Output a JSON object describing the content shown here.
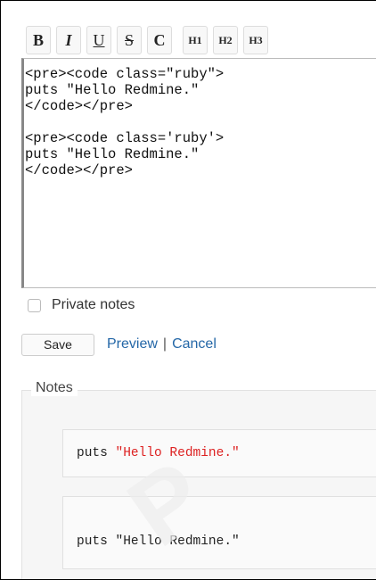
{
  "toolbar": {
    "bold": "B",
    "italic": "I",
    "underline": "U",
    "strike": "S",
    "code": "C",
    "h1": "H1",
    "h2": "H2",
    "h3": "H3"
  },
  "editor": {
    "value": "<pre><code class=\"ruby\">\nputs \"Hello Redmine.\"\n</code></pre>\n\n<pre><code class='ruby'>\nputs \"Hello Redmine.\"\n</code></pre>"
  },
  "private_notes": {
    "label": "Private notes",
    "checked": false
  },
  "actions": {
    "save": "Save",
    "preview": "Preview",
    "separator": "|",
    "cancel": "Cancel"
  },
  "notes": {
    "legend": "Notes",
    "block1": {
      "prefix": "puts ",
      "string": "\"Hello Redmine.\""
    },
    "block2": {
      "text": "puts \"Hello Redmine.\""
    }
  },
  "colors": {
    "link": "#2467a7",
    "string": "#dd2222"
  }
}
